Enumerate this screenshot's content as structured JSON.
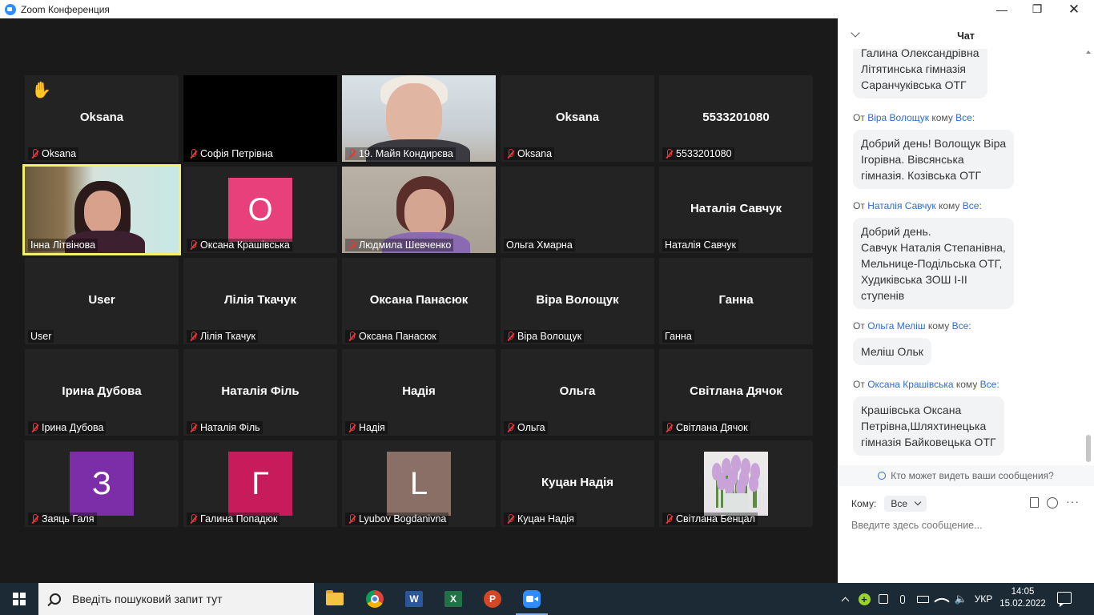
{
  "window": {
    "title": "Zoom Конференция",
    "minimize": "—",
    "maximize": "❐",
    "close": "✕"
  },
  "tiles": [
    {
      "center": "Oksana",
      "label": "Oksana",
      "muted": true,
      "hand": "✋"
    },
    {
      "center": "",
      "label": "Софія Петрівна",
      "muted": true
    },
    {
      "center": "",
      "label": "19. Майя Кондирєва",
      "muted": true
    },
    {
      "center": "Oksana",
      "label": "Oksana",
      "muted": true
    },
    {
      "center": "5533201080",
      "label": "5533201080",
      "muted": true
    },
    {
      "center": "",
      "label": "Інна Літвінова",
      "muted": false
    },
    {
      "center": "",
      "label": "Оксана Крашівська",
      "muted": true,
      "avatar": "О",
      "avatar_color": "#e8407a"
    },
    {
      "center": "",
      "label": "Людмила Шевченко",
      "muted": true
    },
    {
      "center": "",
      "label": "Ольга Хмарна",
      "muted": false
    },
    {
      "center": "Наталія Савчук",
      "label": "Наталія Савчук",
      "muted": false
    },
    {
      "center": "User",
      "label": "User",
      "muted": false
    },
    {
      "center": "Лілія Ткачук",
      "label": "Лілія Ткачук",
      "muted": true
    },
    {
      "center": "Оксана Панасюк",
      "label": "Оксана Панасюк",
      "muted": true
    },
    {
      "center": "Віра Волощук",
      "label": "Віра Волощук",
      "muted": true
    },
    {
      "center": "Ганна",
      "label": "Ганна",
      "muted": false
    },
    {
      "center": "Ірина Дубова",
      "label": "Ірина Дубова",
      "muted": true
    },
    {
      "center": "Наталія Філь",
      "label": "Наталія Філь",
      "muted": true
    },
    {
      "center": "Надія",
      "label": "Надія",
      "muted": true
    },
    {
      "center": "Ольга",
      "label": "Ольга",
      "muted": true
    },
    {
      "center": "Світлана Дячок",
      "label": "Світлана Дячок",
      "muted": true
    },
    {
      "center": "",
      "label": "Заяць Галя",
      "muted": true,
      "avatar": "З",
      "avatar_color": "#7b2ea8"
    },
    {
      "center": "",
      "label": "Галина Попадюк",
      "muted": true,
      "avatar": "Г",
      "avatar_color": "#c81b5b"
    },
    {
      "center": "",
      "label": "Lyubov Bogdanivna",
      "muted": true,
      "avatar": "L",
      "avatar_color": "#8a6f66"
    },
    {
      "center": "Куцан Надія",
      "label": "Куцан Надія",
      "muted": true
    },
    {
      "center": "",
      "label": "Світлана Бенцал",
      "muted": true
    }
  ],
  "chat": {
    "title": "Чат",
    "messages": [
      {
        "from": "",
        "to": "",
        "text": "Галина Олександрівна\nЛітятинська гімназія\nСаранчуківська ОТГ"
      },
      {
        "prefix": "От",
        "from": "Віра Волощук",
        "mid": "кому",
        "to": "Все:",
        "text": "Добрий день! Волощук Віра\nІгорівна.  Вівсянська\nгімназія. Козівська ОТГ"
      },
      {
        "prefix": "От",
        "from": "Наталія Савчук",
        "mid": "кому",
        "to": "Все:",
        "text": "Добрий день.\nСавчук Наталія Степанівна,\nМельнице-Подільська ОТГ,\nХудиківська ЗОШ  І-ІІ\nступенів"
      },
      {
        "prefix": "От",
        "from": "Ольга Меліш",
        "mid": "кому",
        "to": "Все:",
        "text": "Меліш Ольк"
      },
      {
        "prefix": "От",
        "from": "Оксана Крашівська",
        "mid": "кому",
        "to": "Все:",
        "text": "Крашівська Оксана\nПетрівна,Шляхтинецька\nгімназія Байковецька ОТГ"
      }
    ],
    "who_can_see": "Кто может видеть ваши сообщения?",
    "to_label": "Кому:",
    "to_value": "Все",
    "input_placeholder": "Введите здесь сообщение..."
  },
  "taskbar": {
    "search_placeholder": "Введіть пошуковий запит тут",
    "apps": [
      "file-explorer",
      "chrome",
      "word",
      "excel",
      "powerpoint",
      "zoom"
    ],
    "language": "УКР",
    "time": "14:05",
    "date": "15.02.2022"
  }
}
